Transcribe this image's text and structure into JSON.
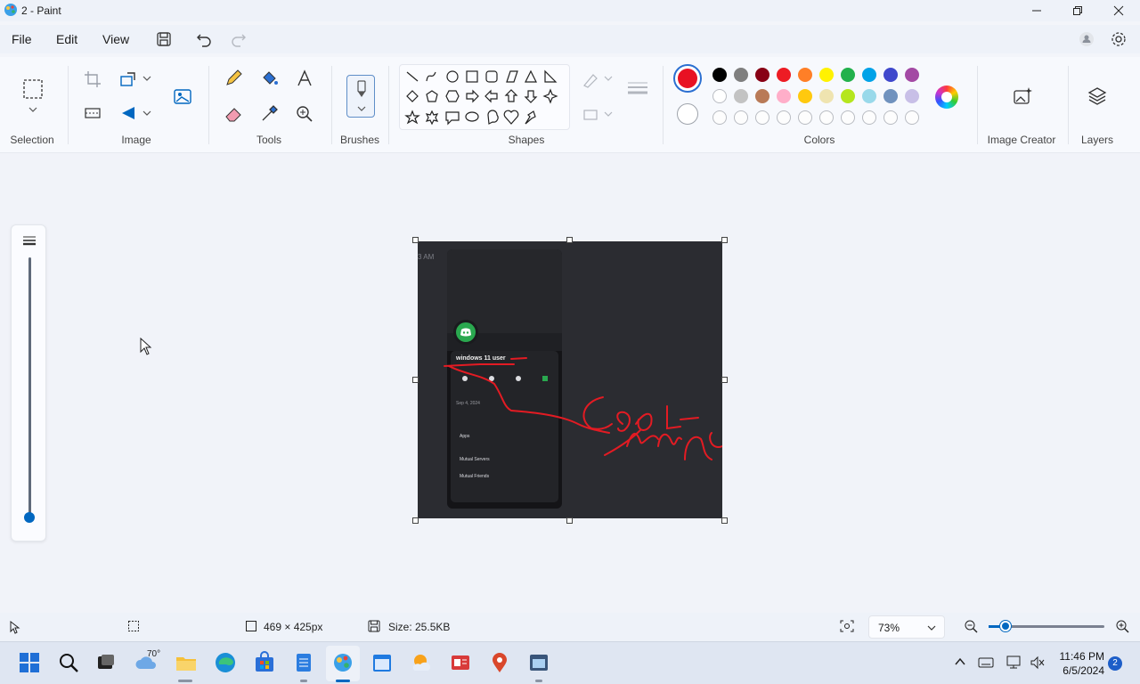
{
  "window": {
    "title": "2 - Paint"
  },
  "menu": {
    "file": "File",
    "edit": "Edit",
    "view": "View"
  },
  "ribbon": {
    "groups": {
      "selection": "Selection",
      "image": "Image",
      "tools": "Tools",
      "brushes": "Brushes",
      "shapes": "Shapes",
      "colors": "Colors",
      "image_creator": "Image Creator",
      "layers": "Layers"
    },
    "primary_color": "#e81123",
    "secondary_color": "#ffffff",
    "palette_row1": [
      "#000000",
      "#7f7f7f",
      "#880015",
      "#ed1c24",
      "#ff7f27",
      "#fff200",
      "#22b14c",
      "#00a2e8",
      "#3f48cc",
      "#a349a4"
    ],
    "palette_row2": [
      "#ffffff",
      "#c3c3c3",
      "#b97a57",
      "#ffaec9",
      "#ffc90e",
      "#efe4b0",
      "#b5e61d",
      "#99d9ea",
      "#7092be",
      "#c8bfe7"
    ]
  },
  "canvas": {
    "phone_screenshot": {
      "time_label": "3 AM",
      "username": "windows 11 user",
      "date": "Sep 4, 2024",
      "apps": "Apps",
      "mutual_servers": "Mutual Servers",
      "mutual_friends": "Mutual Friends"
    }
  },
  "status": {
    "canvas_size": "469 × 425px",
    "file_size": "Size: 25.5KB",
    "zoom": "73%"
  },
  "taskbar": {
    "weather_temp": "70°",
    "time": "11:46 PM",
    "date": "6/5/2024",
    "notification_count": "2"
  }
}
